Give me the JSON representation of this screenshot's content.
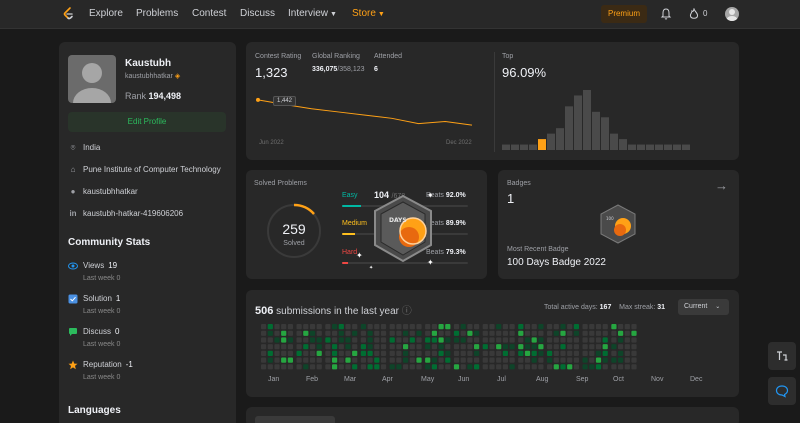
{
  "nav": {
    "links": [
      "Explore",
      "Problems",
      "Contest",
      "Discuss",
      "Interview",
      "Store"
    ],
    "premium": "Premium",
    "streak": "0"
  },
  "profile": {
    "name": "Kaustubh",
    "username": "kaustubhhatkar",
    "rank_label": "Rank",
    "rank": "194,498",
    "edit_label": "Edit Profile",
    "location": "India",
    "school": "Pune Institute of Computer Technology",
    "github": "kaustubhhatkar",
    "linkedin": "kaustubh-hatkar-419606206"
  },
  "community": {
    "title": "Community Stats",
    "stats": [
      {
        "label": "Views",
        "value": "19",
        "sub": "Last week 0",
        "color": "#2196f3"
      },
      {
        "label": "Solution",
        "value": "1",
        "sub": "Last week 0",
        "color": "#4a90e2"
      },
      {
        "label": "Discuss",
        "value": "0",
        "sub": "Last week 0",
        "color": "#2cbb5d"
      },
      {
        "label": "Reputation",
        "value": "-1",
        "sub": "Last week 0",
        "color": "#ffa116"
      }
    ],
    "languages_title": "Languages"
  },
  "contest": {
    "rating_label": "Contest Rating",
    "rating": "1,323",
    "global_label": "Global Ranking",
    "global_rank": "336,075",
    "global_total": "/358,123",
    "attended_label": "Attended",
    "attended": "6",
    "tooltip": "1,442",
    "start_label": "Jun 2022",
    "end_label": "Dec 2022",
    "top_label": "Top",
    "top_value": "96.09%",
    "line_color": "#ffa116",
    "rating_series": [
      1442,
      1420,
      1400,
      1385,
      1370,
      1355,
      1330,
      1340,
      1323
    ],
    "histogram": [
      1,
      1,
      1,
      1,
      2,
      3,
      4,
      8,
      10,
      11,
      7,
      6,
      3,
      2,
      1,
      1,
      1,
      1,
      1,
      1,
      1
    ],
    "histogram_highlight_index": 4
  },
  "solved": {
    "title": "Solved Problems",
    "total": "259",
    "total_label": "Solved",
    "ring_color": "#ffa116",
    "rows": [
      {
        "label": "Easy",
        "count": "104",
        "total": "/678",
        "beats_label": "Beats",
        "beats": "92.0%",
        "color": "#00b8a3",
        "fraction": 0.153
      },
      {
        "label": "Medium",
        "count": "",
        "total": "",
        "beats_label": "Beats",
        "beats": "89.9%",
        "color": "#ffc01e",
        "fraction": 0.1
      },
      {
        "label": "Hard",
        "count": "",
        "total": "",
        "beats_label": "Beats",
        "beats": "79.3%",
        "color": "#ef4743",
        "fraction": 0.05
      }
    ],
    "badge_text": "DAYS"
  },
  "badges": {
    "label": "Badges",
    "count": "1",
    "recent_label": "Most Recent Badge",
    "recent_name": "100 Days Badge 2022",
    "badge_small_text": "100"
  },
  "submissions": {
    "count": "506",
    "label": "submissions in the last year",
    "active_label": "Total active days:",
    "active": "167",
    "streak_label": "Max streak:",
    "streak": "31",
    "dropdown": "Current",
    "months": [
      "Jan",
      "Feb",
      "Mar",
      "Apr",
      "May",
      "Jun",
      "Jul",
      "Aug",
      "Sep",
      "Oct",
      "Nov",
      "Dec"
    ],
    "level_colors": [
      "#393939",
      "#0e4429",
      "#006d32",
      "#26a641"
    ]
  }
}
